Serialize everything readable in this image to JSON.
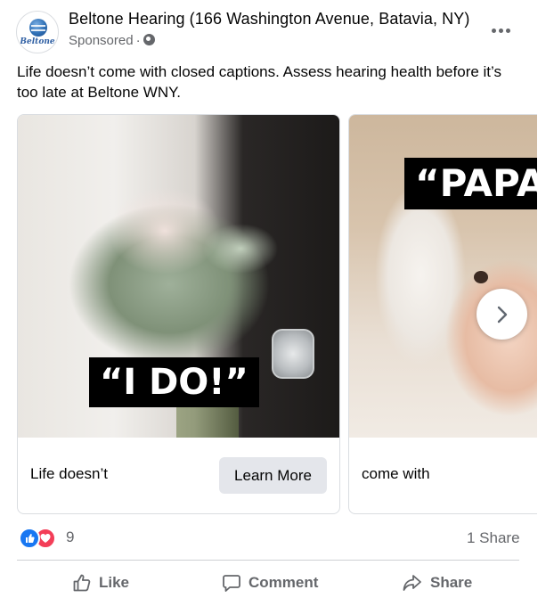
{
  "post": {
    "page_name": "Beltone Hearing (166 Washington Avenue, Batavia, NY)",
    "sponsored_label": "Sponsored",
    "separator": "·",
    "avatar_text": "Beltone",
    "text": "Life doesn’t come with closed captions. Assess hearing health before it’s too late at Beltone WNY."
  },
  "carousel": {
    "cards": [
      {
        "caption": "“I DO!”",
        "label": "Life doesn’t",
        "cta": "Learn More"
      },
      {
        "caption": "“PAPA",
        "label": "come with"
      }
    ]
  },
  "engagement": {
    "reaction_count": "9",
    "share_count": "1 Share"
  },
  "actions": {
    "like": "Like",
    "comment": "Comment",
    "share": "Share"
  },
  "colors": {
    "facebook_blue": "#1877f2",
    "love_red": "#f33e58",
    "secondary_text": "#65676b",
    "button_gray": "#e4e6eb"
  },
  "icons": [
    "globe-icon",
    "more-options-icon",
    "chevron-right-icon",
    "like-reaction-icon",
    "love-reaction-icon",
    "thumbs-up-icon",
    "comment-icon",
    "share-icon"
  ]
}
